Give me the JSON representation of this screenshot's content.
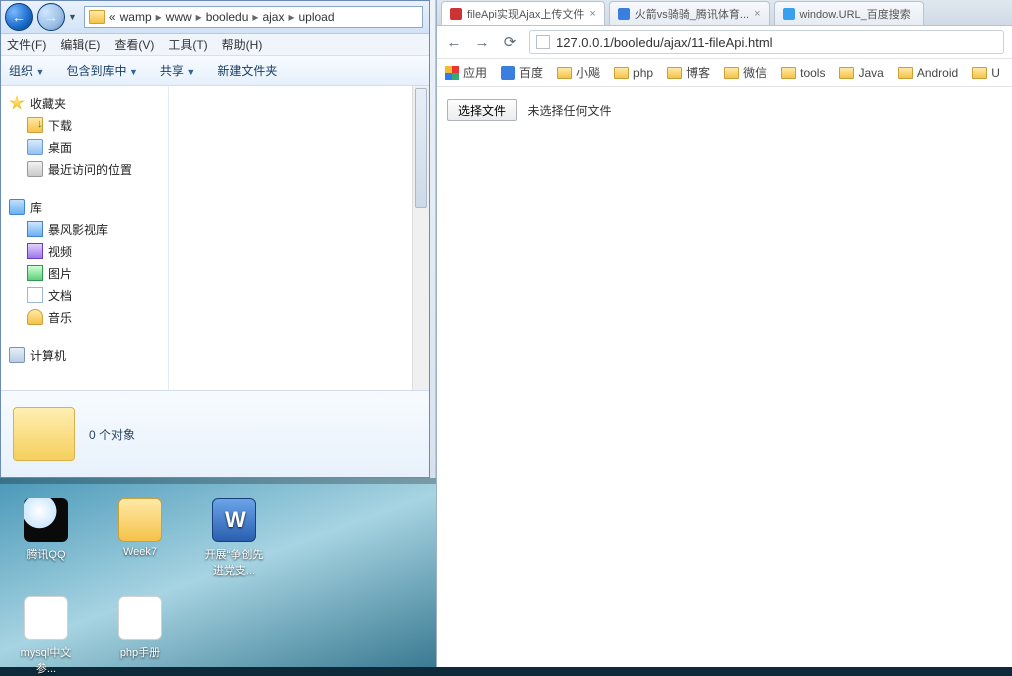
{
  "explorer": {
    "breadcrumb": {
      "pre": "«",
      "items": [
        "wamp",
        "www",
        "booledu",
        "ajax",
        "upload"
      ]
    },
    "menus": [
      "文件(F)",
      "编辑(E)",
      "查看(V)",
      "工具(T)",
      "帮助(H)"
    ],
    "toolbar": {
      "organize": "组织",
      "include": "包含到库中",
      "share": "共享",
      "newfolder": "新建文件夹"
    },
    "tree": {
      "favorites": "收藏夹",
      "downloads": "下载",
      "desktop": "桌面",
      "recent": "最近访问的位置",
      "library": "库",
      "baofeng": "暴风影视库",
      "video": "视频",
      "pictures": "图片",
      "docs": "文档",
      "music": "音乐",
      "computer": "计算机"
    },
    "details": {
      "count": "0 个对象"
    }
  },
  "desktop": {
    "icons1": [
      {
        "label": "腾讯QQ"
      },
      {
        "label": "Week7"
      },
      {
        "label": "开展“争创先进党支..."
      }
    ],
    "icons2": [
      {
        "label": "mysql中文参..."
      },
      {
        "label": "php手册"
      }
    ]
  },
  "chrome": {
    "tabs": [
      {
        "title": "fileApi实现Ajax上传文件",
        "active": true
      },
      {
        "title": "火箭vs骑骑_腾讯体育...",
        "active": false
      },
      {
        "title": "window.URL_百度搜索",
        "active": false
      }
    ],
    "url": "127.0.0.1/booledu/ajax/11-fileApi.html",
    "bookmarks": [
      {
        "label": "应用",
        "kind": "apps"
      },
      {
        "label": "百度",
        "kind": "baidu"
      },
      {
        "label": "小飚",
        "kind": "fold"
      },
      {
        "label": "php",
        "kind": "fold"
      },
      {
        "label": "博客",
        "kind": "fold"
      },
      {
        "label": "微信",
        "kind": "fold"
      },
      {
        "label": "tools",
        "kind": "fold"
      },
      {
        "label": "Java",
        "kind": "fold"
      },
      {
        "label": "Android",
        "kind": "fold"
      },
      {
        "label": "U",
        "kind": "fold"
      }
    ],
    "page": {
      "button": "选择文件",
      "msg": "未选择任何文件"
    }
  }
}
